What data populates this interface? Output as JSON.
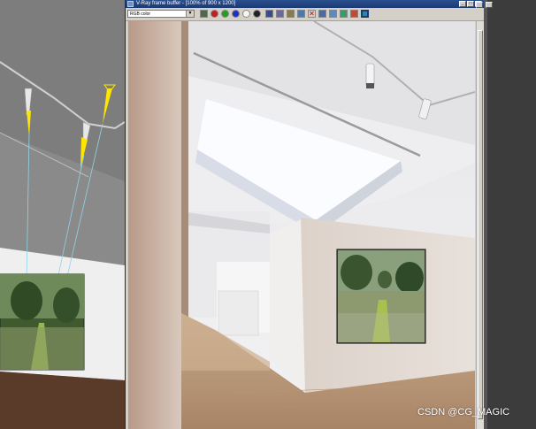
{
  "vfb": {
    "title": "V-Ray frame buffer - [100% of 900 x 1200]",
    "channel": "RGB color",
    "window_buttons": [
      "_",
      "□",
      "×"
    ]
  },
  "watermark": "CSDN @CG_MAGIC",
  "colors": {
    "titlebar": "#1c3a73",
    "window_face": "#d4d0c8",
    "viewport_bg": "#7a7a7a",
    "light_cone": "#ffe600"
  }
}
